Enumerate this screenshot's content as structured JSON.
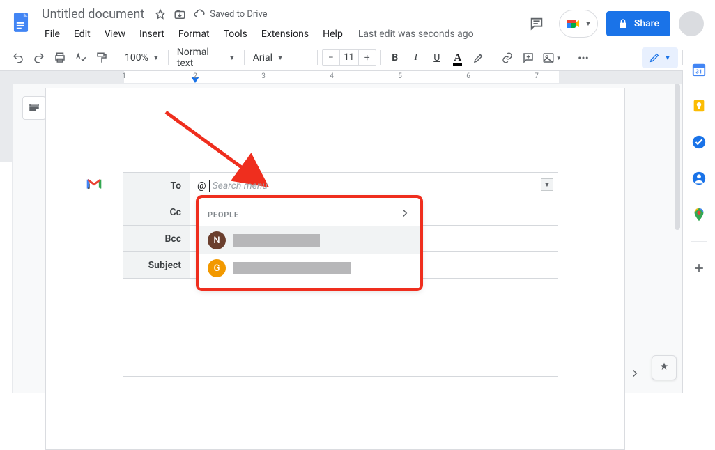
{
  "header": {
    "title": "Untitled document",
    "drive_status": "Saved to Drive",
    "share_label": "Share",
    "last_edit": "Last edit was seconds ago"
  },
  "menu": {
    "items": [
      "File",
      "Edit",
      "View",
      "Insert",
      "Format",
      "Tools",
      "Extensions",
      "Help"
    ]
  },
  "toolbar": {
    "zoom": "100%",
    "style": "Normal text",
    "font": "Arial",
    "font_size": "11"
  },
  "mail_draft": {
    "labels": {
      "to": "To",
      "cc": "Cc",
      "bcc": "Bcc",
      "subject": "Subject"
    },
    "to_prefix": "@",
    "to_placeholder": "Search menu"
  },
  "people_popover": {
    "header": "PEOPLE",
    "items": [
      {
        "initial": "N",
        "color": "#6b3f2e",
        "redact_width": 125
      },
      {
        "initial": "G",
        "color": "#f29900",
        "redact_width": 170
      }
    ]
  },
  "ruler": {
    "numbers": [
      1,
      2,
      3,
      4,
      5,
      6,
      7
    ]
  },
  "sidepanel": {
    "items": [
      "calendar",
      "keep",
      "tasks",
      "contacts",
      "maps"
    ]
  }
}
